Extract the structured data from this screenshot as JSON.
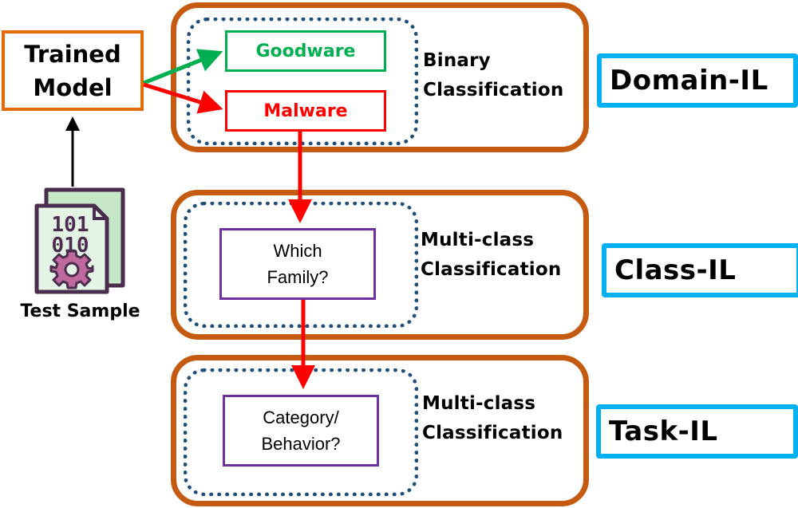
{
  "trained_model": {
    "line1": "Trained",
    "line2": "Model"
  },
  "test_sample": {
    "label": "Test Sample",
    "icon_digits_row1": "101",
    "icon_digits_row2": "010"
  },
  "tiers": [
    {
      "outputs": [
        {
          "label": "Goodware",
          "color": "#00b050"
        },
        {
          "label": "Malware",
          "color": "#ff0000"
        }
      ],
      "classification": {
        "line1": "Binary",
        "line2": "Classification"
      },
      "il_label": "Domain-IL"
    },
    {
      "question": {
        "line1": "Which",
        "line2": "Family?"
      },
      "classification": {
        "line1": "Multi-class",
        "line2": "Classification"
      },
      "il_label": "Class-IL"
    },
    {
      "question": {
        "line1": "Category/",
        "line2": "Behavior?"
      },
      "classification": {
        "line1": "Multi-class",
        "line2": "Classification"
      },
      "il_label": "Task-IL"
    }
  ],
  "colors": {
    "panel_border": "#c55a11",
    "dotted_border": "#1f4e79",
    "il_border": "#00b0f0",
    "question_border": "#7030a0",
    "trained_model_border": "#e36c09",
    "goodware": "#00b050",
    "malware": "#ff0000"
  }
}
